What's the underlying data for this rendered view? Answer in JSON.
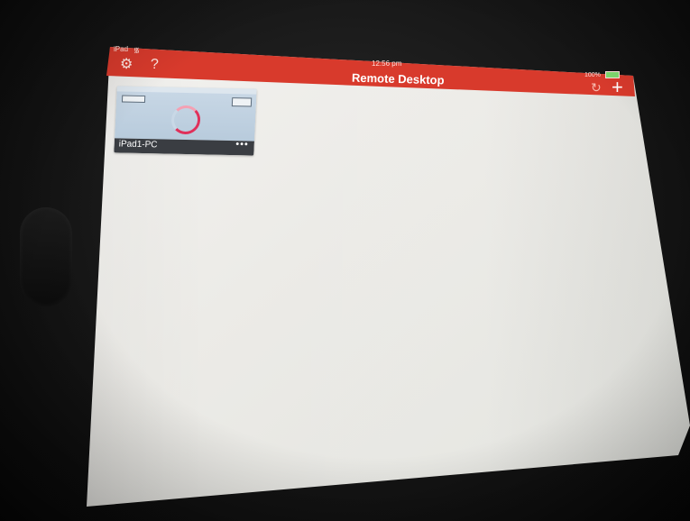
{
  "status_bar": {
    "carrier": "iPad",
    "wifi_icon": "wifi-icon",
    "time": "12:56 pm",
    "battery": "100%",
    "battery_icon": "battery-icon"
  },
  "header": {
    "title": "Remote Desktop",
    "settings_icon": "gear-icon",
    "help_icon": "?",
    "refresh_icon": "refresh-icon",
    "add_icon": "+",
    "color": "#d83a2c"
  },
  "connections": [
    {
      "name": "iPad1-PC",
      "more_icon": "•••"
    }
  ]
}
